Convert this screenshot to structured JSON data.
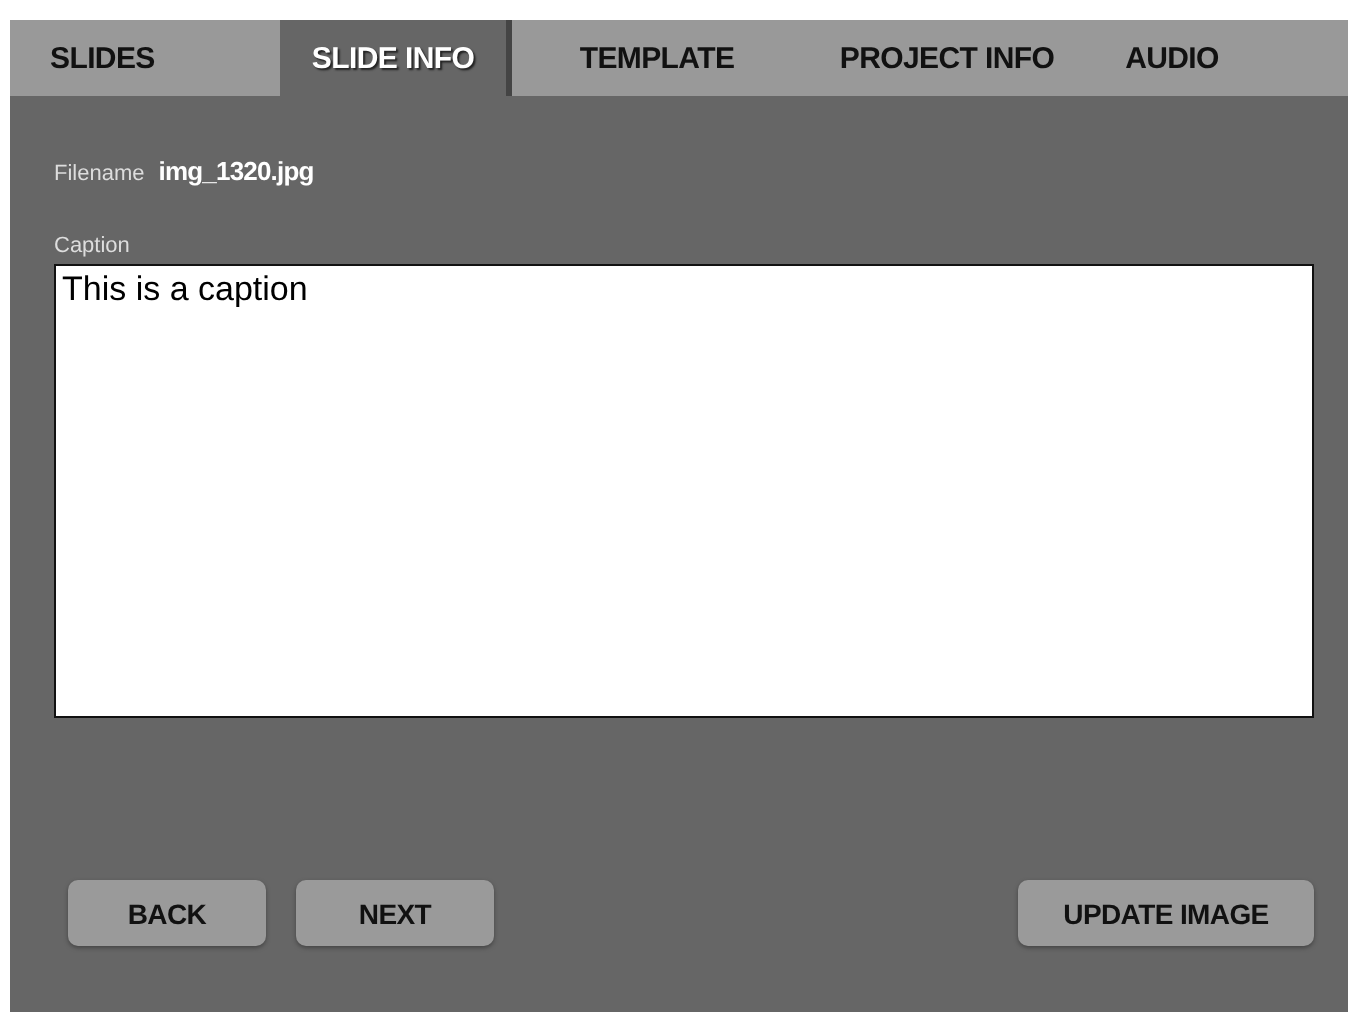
{
  "tabs": [
    {
      "label": "SLIDES",
      "selected": false
    },
    {
      "label": "SLIDE INFO",
      "selected": true
    },
    {
      "label": "TEMPLATE",
      "selected": false
    },
    {
      "label": "PROJECT INFO",
      "selected": false
    },
    {
      "label": "AUDIO",
      "selected": false
    }
  ],
  "filename": {
    "label": "Filename",
    "value": "img_1320.jpg"
  },
  "caption": {
    "label": "Caption",
    "value": "This is a caption"
  },
  "buttons": [
    "BACK",
    "NEXT",
    "UPDATE IMAGE"
  ]
}
